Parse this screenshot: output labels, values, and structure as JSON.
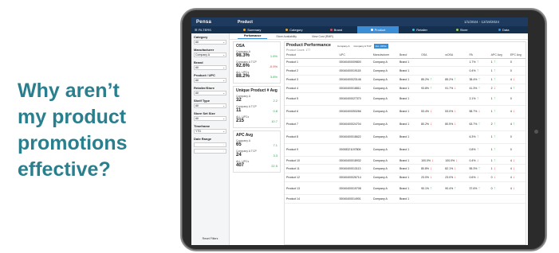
{
  "headline": [
    "Why aren’t",
    "my product",
    "promotions",
    "effective?"
  ],
  "app": {
    "logo": "Pensa",
    "page_title": "Product",
    "date_range": "1/1/2024 - 12/19/2024"
  },
  "nav": {
    "filters_label": "FILTERS",
    "tabs": [
      {
        "label": "Summary",
        "color": "#f0a830"
      },
      {
        "label": "Category",
        "color": "#f0a830"
      },
      {
        "label": "Brand",
        "color": "#e14b4b"
      },
      {
        "label": "Product",
        "color": "#ffffff"
      },
      {
        "label": "Retailer",
        "color": "#3bc0e0"
      },
      {
        "label": "Store",
        "color": "#9ad24a"
      },
      {
        "label": "Data",
        "color": "#3b8ed6"
      }
    ]
  },
  "filters": [
    {
      "label": "Category",
      "value": "All"
    },
    {
      "label": "Manufacturer",
      "value": "Company A"
    },
    {
      "label": "Brand",
      "value": "All"
    },
    {
      "label": "Product / UPC",
      "value": "All"
    },
    {
      "label": "Retailer/Store",
      "value": "All"
    },
    {
      "label": "Shelf Type",
      "value": "All"
    },
    {
      "label": "Store Set Size",
      "value": "All"
    },
    {
      "label": "Timeframe",
      "value": "YTD"
    }
  ],
  "date_range_filter": {
    "label": "Date Range"
  },
  "reset_label": "Reset Filters",
  "subtabs": [
    "Performance",
    "Store Availability",
    "View Cost (RMR)"
  ],
  "kpi_cards": [
    {
      "title": "OSA",
      "rows": [
        {
          "name": "Company A",
          "value": "98.3%",
          "change": "1.6%",
          "dir": "pos"
        },
        {
          "name": "Company A TCP",
          "value": "92.6%",
          "change": "-0.9%",
          "dir": "neg"
        },
        {
          "name": "ALL UPCs",
          "value": "88.2%",
          "change": "3.8%",
          "dir": "pos"
        }
      ]
    },
    {
      "title": "Unique Product # Avg",
      "rows": [
        {
          "name": "Company A",
          "value": "32",
          "change": "2.2",
          "dir": "pos"
        },
        {
          "name": "Company A TCP",
          "value": "11",
          "change": "0.8",
          "dir": "pos"
        },
        {
          "name": "ALL UPCs",
          "value": "215",
          "change": "10.7",
          "dir": "pos"
        }
      ]
    },
    {
      "title": "APC Avg",
      "rows": [
        {
          "name": "Company A",
          "value": "65",
          "change": "7.1",
          "dir": "pos"
        },
        {
          "name": "Company A TCP",
          "value": "24",
          "change": "3.3",
          "dir": "pos"
        },
        {
          "name": "ALL UPCs",
          "value": "407",
          "change": "22.5",
          "dir": "pos"
        }
      ]
    }
  ],
  "table": {
    "title": "Product Performance",
    "toggles": [
      "Company A",
      "Company A TCP",
      "ALL UPCs"
    ],
    "count": "Product Count: 177",
    "columns": [
      "Product",
      "UPC",
      "Manufacturer",
      "Brand",
      "OSA",
      "wOSA",
      "PA",
      "APC Avg",
      "EPC Avg"
    ],
    "rows": [
      {
        "product": "Product 1",
        "upc": "00040400009800",
        "mfr": "Company A",
        "brand": "Brand 1",
        "osa": "",
        "wosa": "",
        "pa": "1.7%",
        "pa_dir": "pos",
        "apc": "1",
        "apc_dir": "pos",
        "epc": "0",
        "tall": false
      },
      {
        "product": "Product 2",
        "upc": "00040400019118",
        "mfr": "Company A",
        "brand": "Brand 1",
        "osa": "",
        "wosa": "",
        "pa": "0.4%",
        "pa_dir": "pos",
        "apc": "1",
        "apc_dir": "pos",
        "epc": "0",
        "tall": false
      },
      {
        "product": "Product 3",
        "upc": "00040400023146",
        "mfr": "Company A",
        "brand": "Brand 1",
        "osa": "85.2%",
        "osa_dir": "pos",
        "wosa": "85.2%",
        "wosa_dir": "pos",
        "pa": "38.4%",
        "pa_dir": "pos",
        "apc": "1",
        "apc_dir": "pos",
        "epc": "4",
        "epc_dir": "neg",
        "tall": false
      },
      {
        "product": "Product 4",
        "upc": "00040400018811",
        "mfr": "Company A",
        "brand": "Brand 1",
        "osa": "93.8%",
        "osa_dir": "pos",
        "wosa": "91.7%",
        "wosa_dir": "neg",
        "pa": "41.3%",
        "pa_dir": "pos",
        "apc": "2",
        "apc_dir": "neg",
        "epc": "4",
        "epc_dir": "pos",
        "tall": false
      },
      {
        "product": "Product 5",
        "upc": "00040400027370",
        "mfr": "Company A",
        "brand": "Brand 1",
        "osa": "",
        "wosa": "",
        "pa": "2.1%",
        "pa_dir": "pos",
        "apc": "1",
        "apc_dir": "pos",
        "epc": "0",
        "tall": true
      },
      {
        "product": "Product 6",
        "upc": "00040400053266",
        "mfr": "Company A",
        "brand": "Brand 1",
        "osa": "53.4%",
        "osa_dir": "neg",
        "wosa": "53.0%",
        "wosa_dir": "neg",
        "pa": "58.7%",
        "pa_dir": "neg",
        "apc": "1",
        "apc_dir": "pos",
        "epc": "4",
        "epc_dir": "neg",
        "tall": true
      },
      {
        "product": "Product 7",
        "upc": "00040400024704",
        "mfr": "Company A",
        "brand": "Brand 1",
        "osa": "80.2%",
        "osa_dir": "neg",
        "wosa": "80.5%",
        "wosa_dir": "neg",
        "pa": "63.7%",
        "pa_dir": "pos",
        "apc": "2",
        "apc_dir": "pos",
        "epc": "4",
        "epc_dir": "pos",
        "tall": true
      },
      {
        "product": "Product 8",
        "upc": "00040400018622",
        "mfr": "Company A",
        "brand": "Brand 1",
        "osa": "",
        "wosa": "",
        "pa": "6.3%",
        "pa_dir": "pos",
        "apc": "1",
        "apc_dir": "pos",
        "epc": "0",
        "tall": true
      },
      {
        "product": "Product 9",
        "upc": "00008321197806",
        "mfr": "Company A",
        "brand": "Brand 1",
        "osa": "",
        "wosa": "",
        "pa": "0.8%",
        "pa_dir": "pos",
        "apc": "1",
        "apc_dir": "pos",
        "epc": "0",
        "tall": true
      },
      {
        "product": "Product 10",
        "upc": "00040400018932",
        "mfr": "Company A",
        "brand": "Brand 1",
        "osa": "100.0%",
        "osa_dir": "neg",
        "wosa": "100.0%",
        "wosa_dir": "neg",
        "pa": "0.4%",
        "pa_dir": "neg",
        "apc": "1",
        "apc_dir": "pos",
        "epc": "4",
        "epc_dir": "neg",
        "tall": false
      },
      {
        "product": "Product 11",
        "upc": "00040400013113",
        "mfr": "Company A",
        "brand": "Brand 1",
        "osa": "80.8%",
        "osa_dir": "neg",
        "wosa": "82.1%",
        "wosa_dir": "neg",
        "pa": "55.3%",
        "pa_dir": "pos",
        "apc": "1",
        "apc_dir": "neg",
        "epc": "4",
        "epc_dir": "neg",
        "tall": false
      },
      {
        "product": "Product 12",
        "upc": "00040400026714",
        "mfr": "Company A",
        "brand": "Brand 1",
        "osa": "23.0%",
        "osa_dir": "neg",
        "wosa": "23.0%",
        "wosa_dir": "neg",
        "pa": "0.6%",
        "pa_dir": "neg",
        "apc": "0",
        "apc_dir": "neg",
        "epc": "4",
        "epc_dir": "neg",
        "tall": false
      },
      {
        "product": "Product 13",
        "upc": "00040400019708",
        "mfr": "Company A",
        "brand": "Brand 1",
        "osa": "90.1%",
        "osa_dir": "pos",
        "wosa": "90.4%",
        "wosa_dir": "pos",
        "pa": "37.6%",
        "pa_dir": "pos",
        "apc": "0",
        "apc_dir": "pos",
        "epc": "4",
        "epc_dir": "neg",
        "tall": true
      },
      {
        "product": "Product 14",
        "upc": "00040400014901",
        "mfr": "Company A",
        "brand": "Brand 1",
        "osa": "",
        "wosa": "",
        "pa": "",
        "apc": "",
        "epc": "",
        "tall": false
      }
    ]
  }
}
